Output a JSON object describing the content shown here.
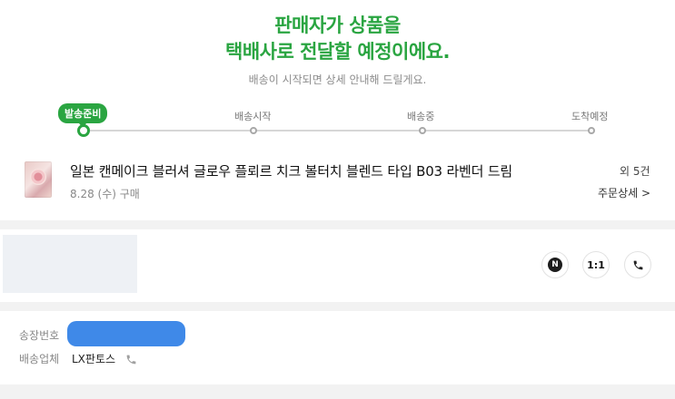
{
  "header": {
    "title_line1": "판매자가 상품을",
    "title_line2": "택배사로 전달할 예정이에요.",
    "subtitle": "배송이 시작되면 상세 안내해 드릴게요."
  },
  "progress": {
    "current_step": 0,
    "steps": [
      {
        "label": "발송준비"
      },
      {
        "label": "배송시작"
      },
      {
        "label": "배송중"
      },
      {
        "label": "도착예정"
      }
    ]
  },
  "product": {
    "name": "일본 캔메이크 블러셔 글로우 플뢰르 치크 볼터치 블렌드 타입 B03 라벤더 드림",
    "date": "8.28 (수) 구매",
    "count": "외 5건",
    "detail_link": "주문상세 >"
  },
  "seller": {
    "naver_icon": "N",
    "one_to_one": "1:1"
  },
  "shipping": {
    "tracking_label": "송장번호",
    "carrier_label": "배송업체",
    "carrier_value": "LX판토스"
  },
  "colors": {
    "accent": "#2aa541",
    "redaction": "#2f7fe6"
  }
}
